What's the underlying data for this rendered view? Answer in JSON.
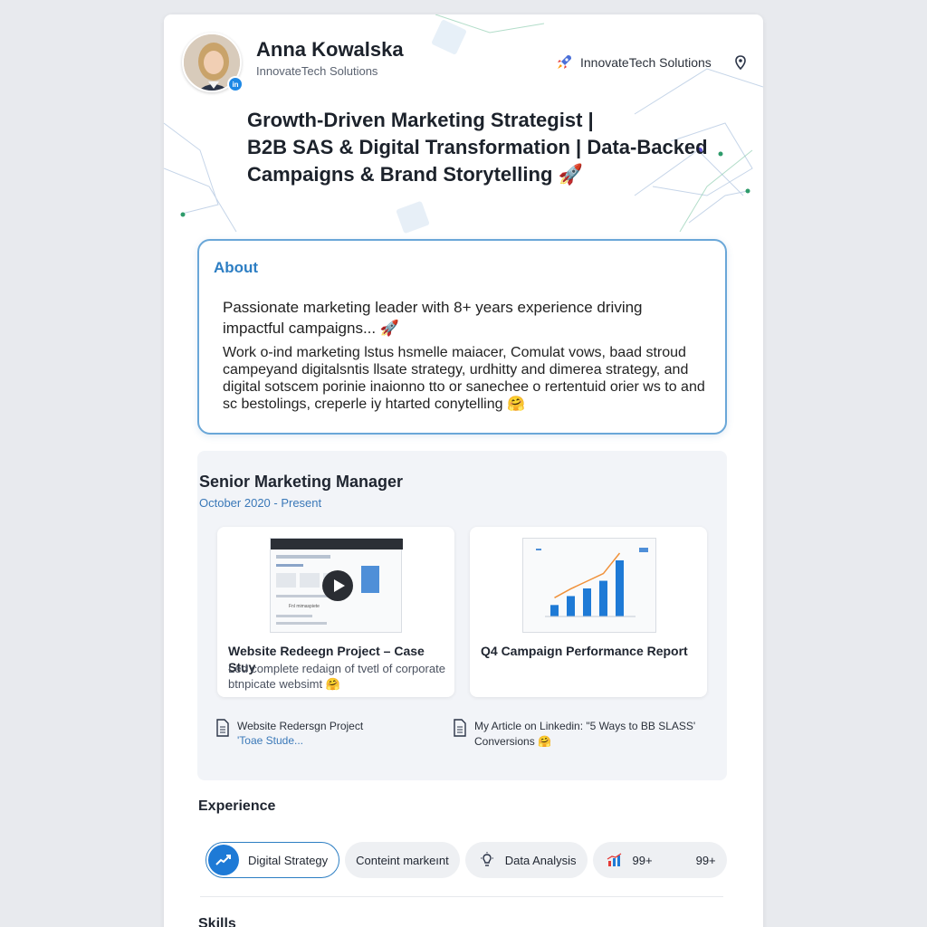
{
  "profile": {
    "name": "Anna Kowalska",
    "company": "InnovateTech Solutions",
    "avatar_badge": "in",
    "headline_lines": [
      "Growth-Driven Marketing Strategist |",
      "B2B SAS & Digital Transformation | Data-Backed",
      "Campaigns & Brand Storytelling 🚀"
    ]
  },
  "header_right": {
    "company": "InnovateTech Solutions",
    "icons": [
      "rocket-icon",
      "location-pin-icon"
    ]
  },
  "about": {
    "title": "About",
    "lead": "Passionate marketing leader with 8+ years experience driving impactful campaigns... 🚀",
    "body": "Work o-ind marketing lstus hsmelle maiacer, Comulat vows, baad stroud campeyand digitalsntis llsate strategy, urdhitty and dimerea strategy, and digital sotscem porinie inaionno tto or sanechee o rertentuid orier ws to and sc bestolings, creperle iy htarted conytelling 🤗"
  },
  "position": {
    "title": "Senior Marketing Manager",
    "dates": "October 2020 - Present",
    "media": [
      {
        "title": "Website Redeegn Project – Case Stuy",
        "description": "Led complete redaign of tvetl of corporate btnpicate websimt 🤗",
        "thumb_caption": "Fnl mimaspiete"
      },
      {
        "title": "Q4 Campaign Performance Report",
        "description": "",
        "chart_bar_values": [
          18,
          32,
          44,
          56,
          88
        ]
      }
    ],
    "links": [
      {
        "title": "Website Redersgn Project",
        "subtitle": "'Toae Stude..."
      },
      {
        "title": "My Article on Linkedin: \"5 Ways to BB SLASS' Conversions 🤗",
        "subtitle": ""
      }
    ]
  },
  "experience": {
    "title": "Experience",
    "pills": [
      {
        "label": "Digital Strategy",
        "icon": "chart-icon",
        "active": true
      },
      {
        "label": "Conteint markeınt",
        "icon": "",
        "active": false
      },
      {
        "label": "Data Analysis",
        "icon": "lightbulb-icon",
        "active": false
      },
      {
        "label": "99+",
        "count": "99+",
        "icon": "bar-chart-icon",
        "active": false
      }
    ]
  },
  "skills": {
    "title": "Skills"
  },
  "colors": {
    "accent": "#2d7ec3",
    "about_border": "#6aa7d8",
    "active_pill": "#1e7ad6",
    "rocket": "#e53935"
  }
}
